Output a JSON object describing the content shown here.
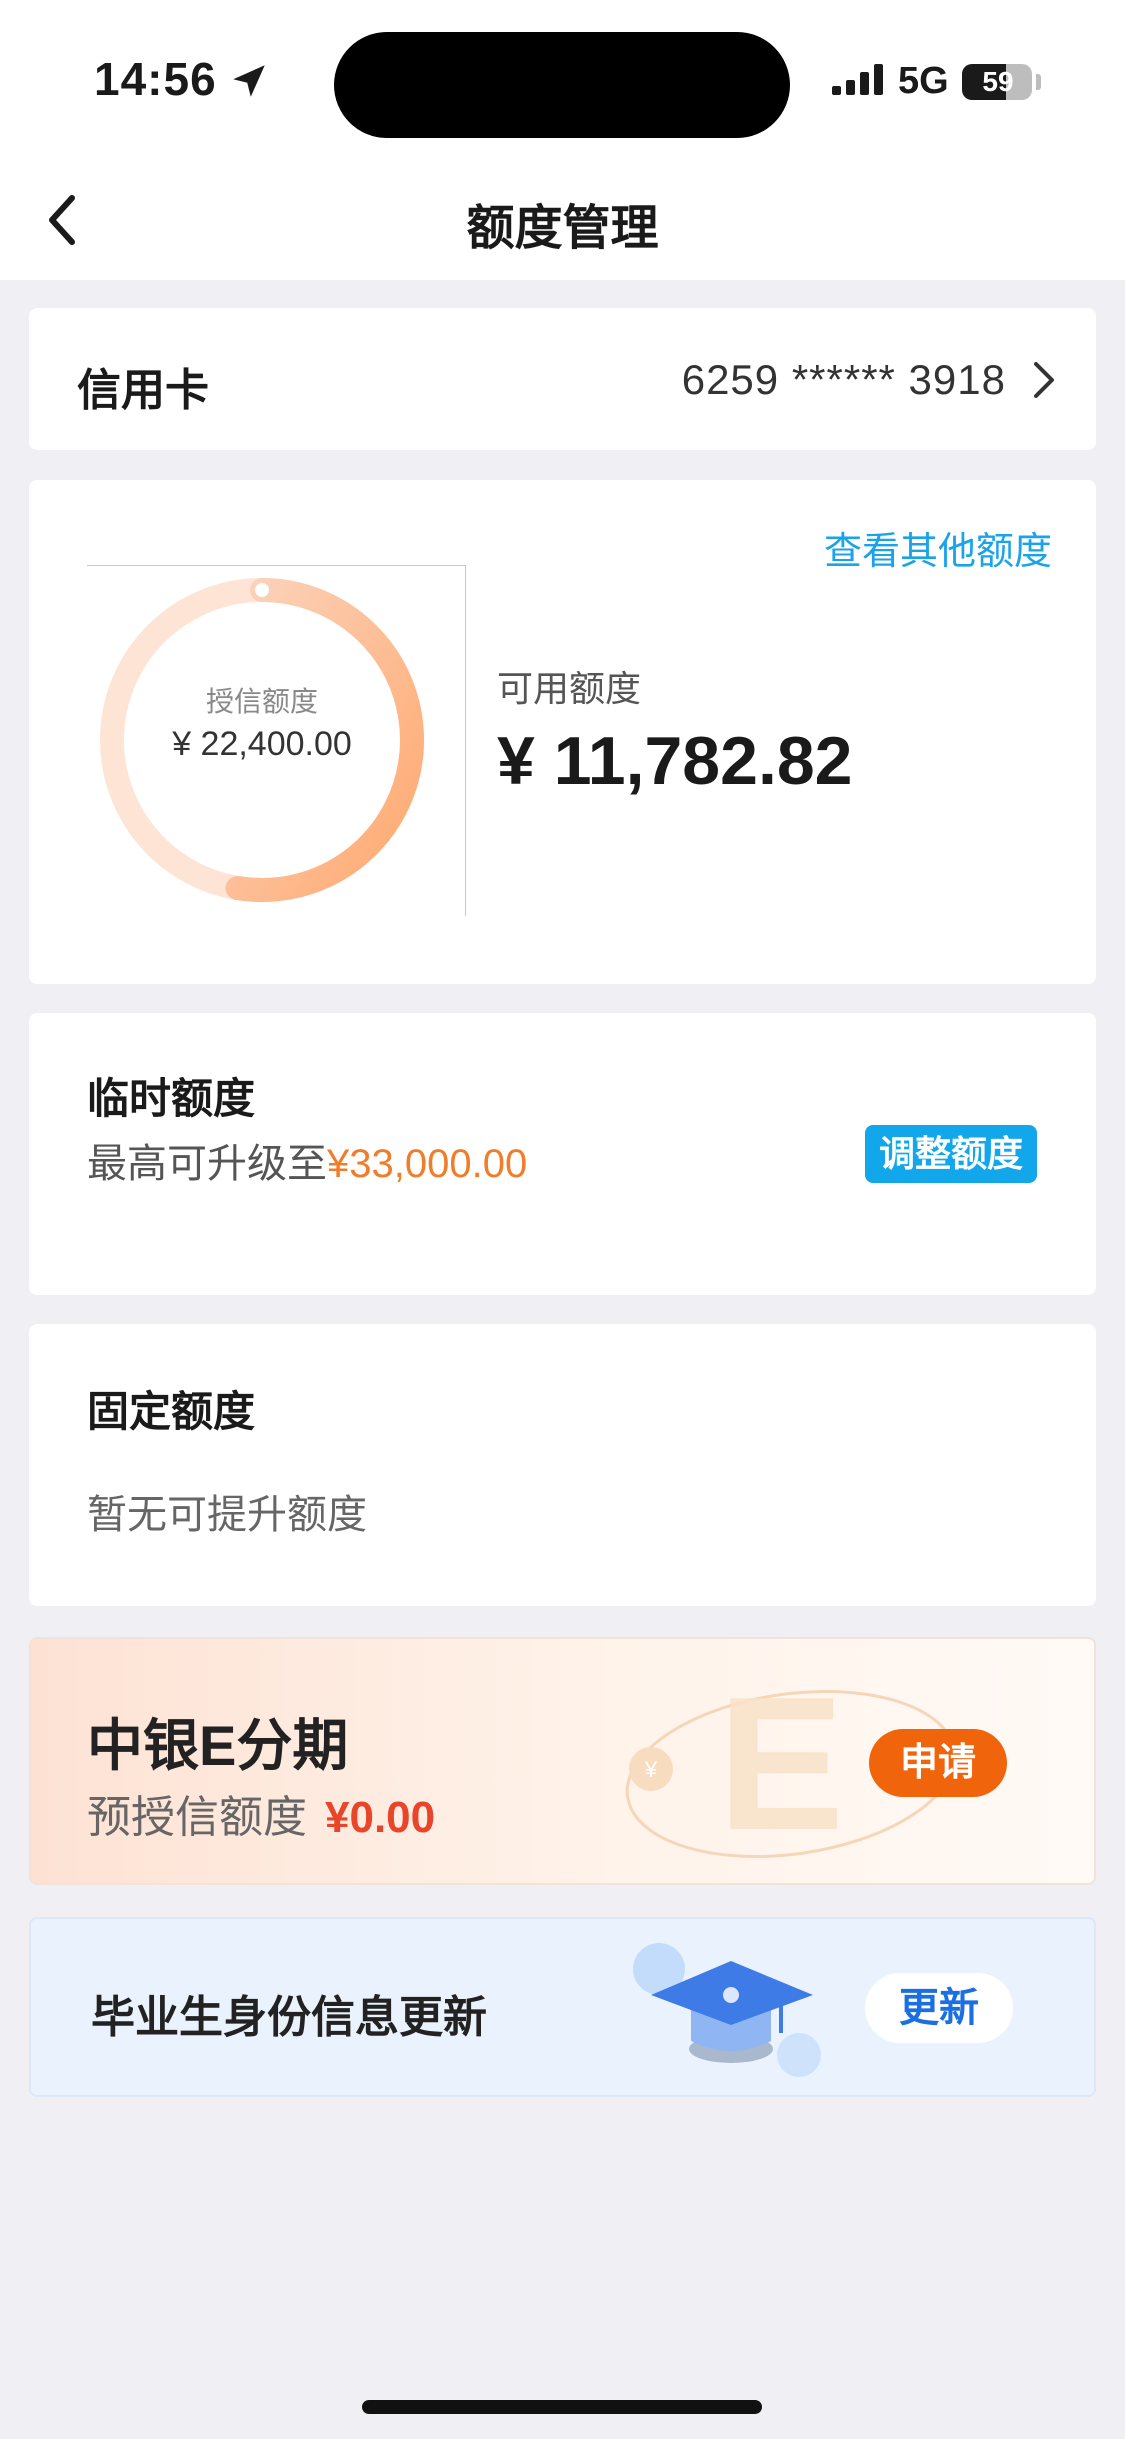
{
  "status_bar": {
    "time": "14:56",
    "network": "5G",
    "battery": "59"
  },
  "nav": {
    "title": "额度管理"
  },
  "card_row": {
    "label": "信用卡",
    "card_number": "6259 ****** 3918"
  },
  "limit": {
    "other_link": "查看其他额度",
    "credit_label": "授信额度",
    "credit_value": "¥ 22,400.00",
    "available_label": "可用额度",
    "available_value": "¥ 11,782.82",
    "available_fraction": 0.526
  },
  "temporary": {
    "title": "临时额度",
    "subtitle_prefix": "最高可升级至",
    "subtitle_amount": "¥33,000.00",
    "button": "调整额度"
  },
  "fixed": {
    "title": "固定额度",
    "subtitle": "暂无可提升额度"
  },
  "installment": {
    "title": "中银E分期",
    "subtitle_label": "预授信额度",
    "subtitle_amount": "¥0.00",
    "button": "申请",
    "deco_letter": "E"
  },
  "graduate": {
    "title": "毕业生身份信息更新",
    "button": "更新"
  },
  "colors": {
    "accent_blue": "#12a7ea",
    "accent_orange": "#f07d2a",
    "apply_orange": "#f0650c",
    "update_blue": "#1b6fe0"
  }
}
